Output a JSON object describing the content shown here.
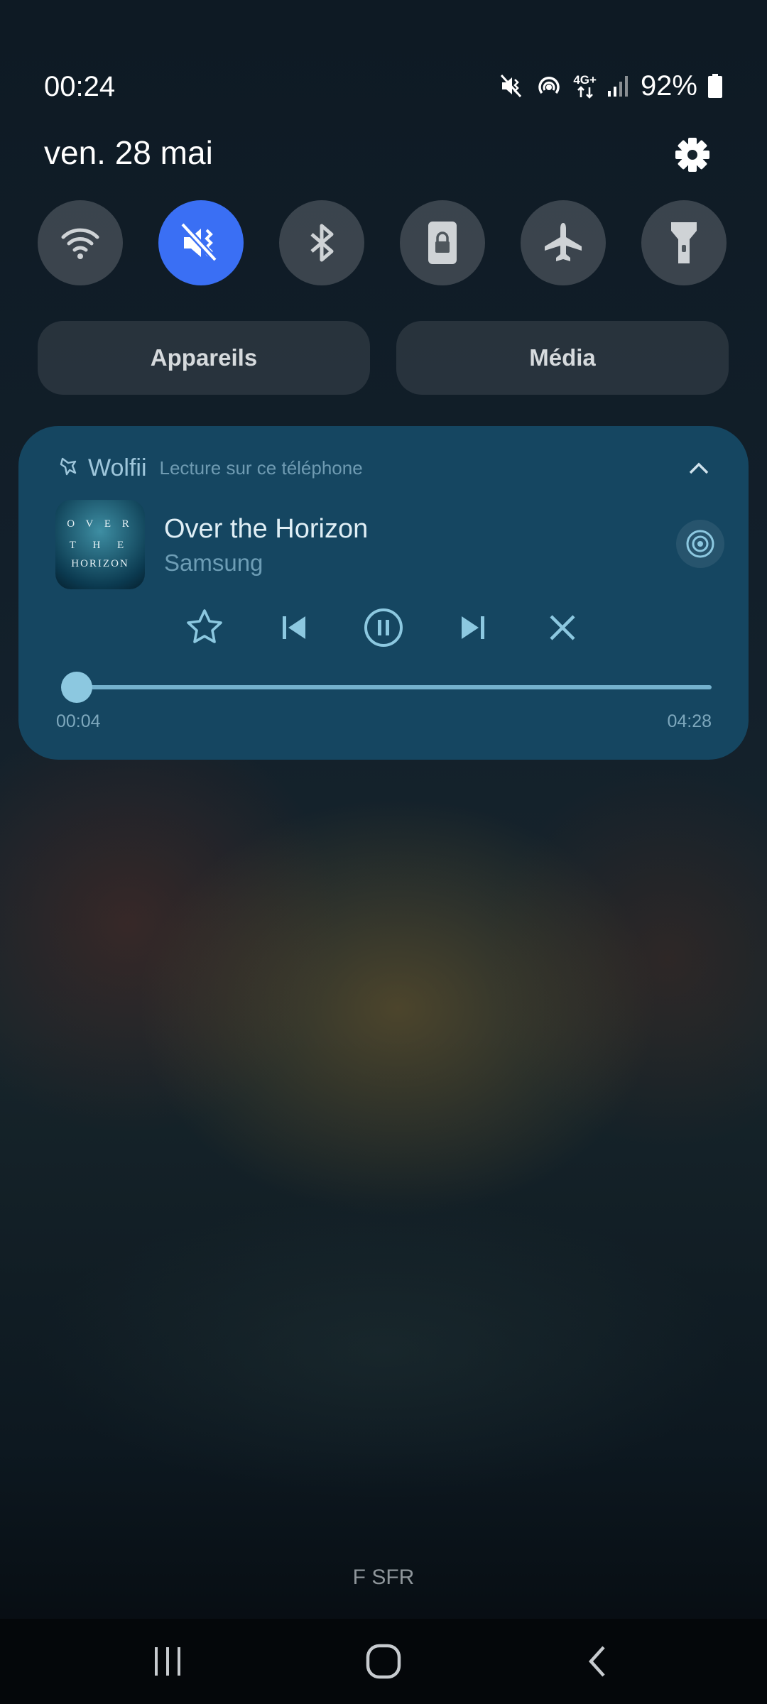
{
  "status_bar": {
    "time": "00:24",
    "battery_percent": "92%",
    "network_label": "4G+",
    "icons": [
      "mute-vibrate-icon",
      "hotspot-icon",
      "mobile-data-icon",
      "signal-icon",
      "battery-icon"
    ]
  },
  "panel": {
    "date": "ven. 28 mai",
    "settings_icon": "gear-icon"
  },
  "quick_settings": [
    {
      "icon": "wifi-icon",
      "active": false
    },
    {
      "icon": "mute-icon",
      "active": true
    },
    {
      "icon": "bluetooth-icon",
      "active": false
    },
    {
      "icon": "screen-lock-icon",
      "active": false
    },
    {
      "icon": "airplane-icon",
      "active": false
    },
    {
      "icon": "flashlight-icon",
      "active": false
    }
  ],
  "buttons": {
    "devices": "Appareils",
    "media": "Média"
  },
  "media": {
    "app_name": "Wolfii",
    "source": "Lecture sur ce téléphone",
    "title": "Over the Horizon",
    "artist": "Samsung",
    "artwork_text": [
      "O V E R",
      "T H E",
      "HORIZON"
    ],
    "elapsed": "00:04",
    "duration": "04:28",
    "progress_fraction": 0.015,
    "controls": [
      "star-icon",
      "previous-icon",
      "pause-icon",
      "next-icon",
      "close-icon"
    ]
  },
  "lock_screen": {
    "carrier": "F SFR"
  },
  "colors": {
    "accent": "#3a6ff4",
    "media_card": "#154661",
    "media_control": "#8cc8e0"
  }
}
